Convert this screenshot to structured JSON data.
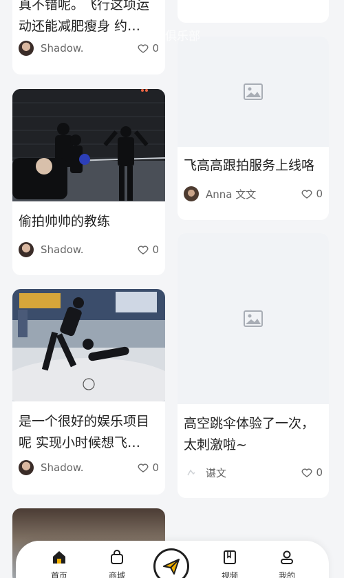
{
  "cards": [
    {
      "title": "真不错呢。飞行这项运动还能减肥瘦身 约…",
      "author": "Shadow.",
      "likes": "0"
    },
    {
      "title": "偷拍帅帅的教练",
      "author": "Shadow.",
      "likes": "0"
    },
    {
      "title": "是一个很好的娱乐项目呢 实现小时候想飞…",
      "author": "Shadow.",
      "likes": "0"
    },
    {
      "title": "飞高高跟拍服务上线咯",
      "author": "Anna 文文",
      "likes": "0"
    },
    {
      "title": "高空跳伞体验了一次，太刺激啦~",
      "author": "谌文",
      "likes": "0"
    }
  ],
  "watermark": "俱乐部",
  "nav": {
    "items": [
      "首页",
      "商城",
      "",
      "视频",
      "我的"
    ]
  },
  "colors": {
    "accent": "#f0b000"
  },
  "icons": [
    "heart-icon",
    "image-placeholder-icon",
    "home-icon",
    "shopping-bag-icon",
    "paper-plane-icon",
    "book-icon",
    "user-icon"
  ]
}
